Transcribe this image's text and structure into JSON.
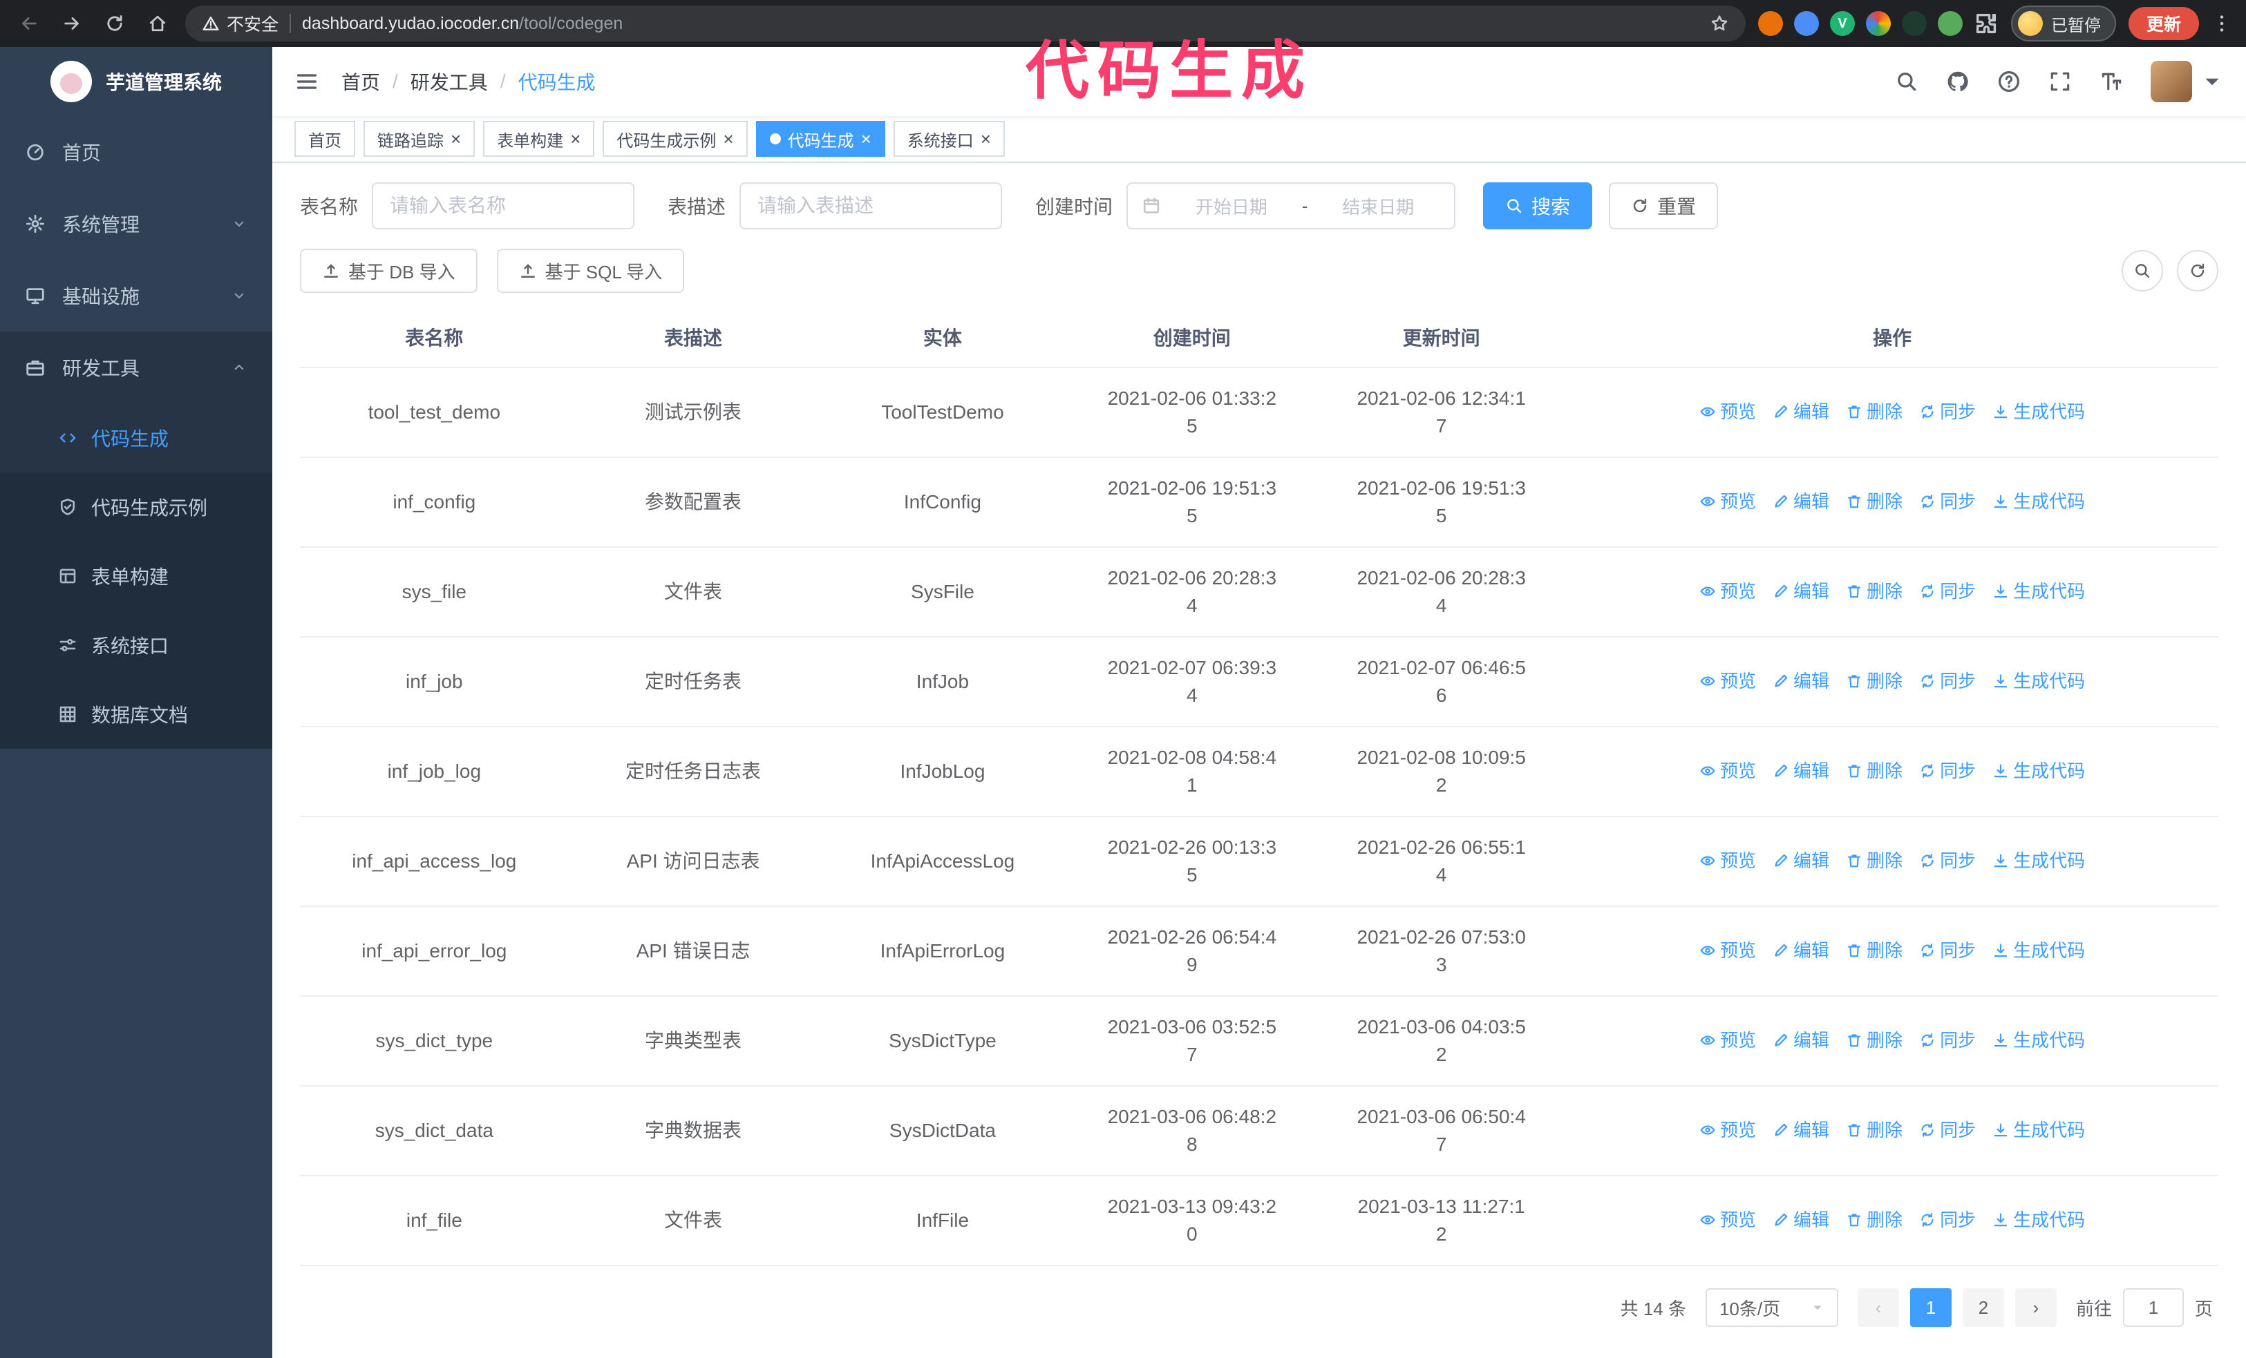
{
  "browser": {
    "security_warning": "不安全",
    "url_host": "dashboard.yudao.iocoder.cn",
    "url_path": "/tool/codegen",
    "paused_badge": "已暂停",
    "update_button": "更新",
    "extensions": [
      {
        "name": "extension-icon-orange",
        "color": "#e8710a",
        "glyph": ""
      },
      {
        "name": "extension-icon-blue",
        "color": "#4e8cf7",
        "glyph": ""
      },
      {
        "name": "extension-icon-vue-devtools",
        "color": "#21b573",
        "glyph": "V"
      },
      {
        "name": "extension-icon-colorful",
        "color": "conic",
        "glyph": ""
      },
      {
        "name": "extension-icon-dark-terminal",
        "color": "#1d3b2f",
        "glyph": ""
      },
      {
        "name": "extension-icon-green-leaf",
        "color": "#57ab5a",
        "glyph": ""
      },
      {
        "name": "extensions-puzzle-icon",
        "color": "",
        "icon": "puzzle",
        "glyph": ""
      }
    ]
  },
  "annotation": {
    "text": "代码生成",
    "color": "#fa3f6e"
  },
  "sidebar": {
    "logo_title": "芋道管理系统",
    "menu": [
      {
        "key": "home",
        "label": "首页",
        "icon": "dashboard",
        "type": "item",
        "state": "none"
      },
      {
        "key": "system",
        "label": "系统管理",
        "icon": "gear",
        "type": "group",
        "state": "collapsed"
      },
      {
        "key": "infra",
        "label": "基础设施",
        "icon": "monitor",
        "type": "group",
        "state": "collapsed"
      },
      {
        "key": "devtools",
        "label": "研发工具",
        "icon": "toolbox",
        "type": "group",
        "state": "expanded"
      }
    ],
    "submenu": [
      {
        "key": "codegen",
        "label": "代码生成",
        "icon": "code",
        "active": true
      },
      {
        "key": "codegen-example",
        "label": "代码生成示例",
        "icon": "shield",
        "active": false
      },
      {
        "key": "form-builder",
        "label": "表单构建",
        "icon": "form",
        "active": false
      },
      {
        "key": "system-api",
        "label": "系统接口",
        "icon": "sliders",
        "active": false
      },
      {
        "key": "db-doc",
        "label": "数据库文档",
        "icon": "grid",
        "active": false
      }
    ]
  },
  "navbar": {
    "breadcrumb": [
      "首页",
      "研发工具",
      "代码生成"
    ]
  },
  "tabs": [
    {
      "key": "home",
      "label": "首页",
      "closable": false,
      "active": false
    },
    {
      "key": "tracer",
      "label": "链路追踪",
      "closable": true,
      "active": false
    },
    {
      "key": "form-builder",
      "label": "表单构建",
      "closable": true,
      "active": false
    },
    {
      "key": "codegen-example",
      "label": "代码生成示例",
      "closable": true,
      "active": false
    },
    {
      "key": "codegen",
      "label": "代码生成",
      "closable": true,
      "active": true
    },
    {
      "key": "system-api",
      "label": "系统接口",
      "closable": true,
      "active": false
    }
  ],
  "filters": {
    "table_name_label": "表名称",
    "table_name_placeholder": "请输入表名称",
    "table_desc_label": "表描述",
    "table_desc_placeholder": "请输入表描述",
    "create_time_label": "创建时间",
    "start_date_placeholder": "开始日期",
    "date_separator": "-",
    "end_date_placeholder": "结束日期",
    "search_button": "搜索",
    "reset_button": "重置"
  },
  "toolbar": {
    "import_db_button": "基于 DB 导入",
    "import_sql_button": "基于 SQL 导入"
  },
  "table": {
    "columns": [
      "表名称",
      "表描述",
      "实体",
      "创建时间",
      "更新时间",
      "操作"
    ],
    "actions": [
      {
        "key": "preview",
        "label": "预览",
        "icon": "eye"
      },
      {
        "key": "edit",
        "label": "编辑",
        "icon": "pencil"
      },
      {
        "key": "delete",
        "label": "删除",
        "icon": "trash"
      },
      {
        "key": "sync",
        "label": "同步",
        "icon": "sync"
      },
      {
        "key": "generate-code",
        "label": "生成代码",
        "icon": "download"
      }
    ],
    "rows": [
      {
        "name": "tool_test_demo",
        "desc": "测试示例表",
        "entity": "ToolTestDemo",
        "created": "2021-02-06 01:33:25",
        "updated": "2021-02-06 12:34:17"
      },
      {
        "name": "inf_config",
        "desc": "参数配置表",
        "entity": "InfConfig",
        "created": "2021-02-06 19:51:35",
        "updated": "2021-02-06 19:51:35"
      },
      {
        "name": "sys_file",
        "desc": "文件表",
        "entity": "SysFile",
        "created": "2021-02-06 20:28:34",
        "updated": "2021-02-06 20:28:34"
      },
      {
        "name": "inf_job",
        "desc": "定时任务表",
        "entity": "InfJob",
        "created": "2021-02-07 06:39:34",
        "updated": "2021-02-07 06:46:56"
      },
      {
        "name": "inf_job_log",
        "desc": "定时任务日志表",
        "entity": "InfJobLog",
        "created": "2021-02-08 04:58:41",
        "updated": "2021-02-08 10:09:52"
      },
      {
        "name": "inf_api_access_log",
        "desc": "API 访问日志表",
        "entity": "InfApiAccessLog",
        "created": "2021-02-26 00:13:35",
        "updated": "2021-02-26 06:55:14"
      },
      {
        "name": "inf_api_error_log",
        "desc": "API 错误日志",
        "entity": "InfApiErrorLog",
        "created": "2021-02-26 06:54:49",
        "updated": "2021-02-26 07:53:03"
      },
      {
        "name": "sys_dict_type",
        "desc": "字典类型表",
        "entity": "SysDictType",
        "created": "2021-03-06 03:52:57",
        "updated": "2021-03-06 04:03:52"
      },
      {
        "name": "sys_dict_data",
        "desc": "字典数据表",
        "entity": "SysDictData",
        "created": "2021-03-06 06:48:28",
        "updated": "2021-03-06 06:50:47"
      },
      {
        "name": "inf_file",
        "desc": "文件表",
        "entity": "InfFile",
        "created": "2021-03-13 09:43:20",
        "updated": "2021-03-13 11:27:12"
      }
    ]
  },
  "pagination": {
    "total_text": "共 14 条",
    "page_size": "10条/页",
    "pages": [
      "1",
      "2"
    ],
    "current_page": "1",
    "goto_label": "前往",
    "goto_value": "1",
    "page_suffix": "页"
  },
  "colors": {
    "primary": "#409eff",
    "sidebar_bg": "#304156",
    "submenu_bg": "#1f2d3d",
    "annotation": "#fa3f6e",
    "update_button": "#e04f3f"
  }
}
